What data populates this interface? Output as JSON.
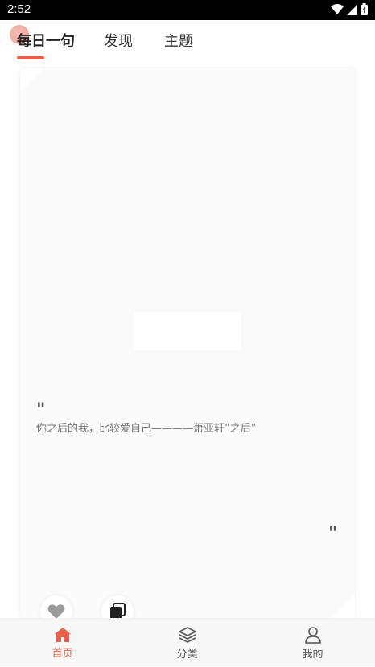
{
  "status_bar": {
    "time": "2:52"
  },
  "tabs": [
    {
      "label": "每日一句",
      "active": true
    },
    {
      "label": "发现",
      "active": false
    },
    {
      "label": "主题",
      "active": false
    }
  ],
  "card": {
    "quote_open": "\"",
    "quote_text": "你之后的我，比较爱自己————萧亚轩”之后”",
    "quote_close": "\""
  },
  "actions": {
    "like_icon": "heart-icon",
    "copy_icon": "copy-icon"
  },
  "bottom_nav": [
    {
      "label": "首页",
      "icon": "home-icon",
      "active": true
    },
    {
      "label": "分类",
      "icon": "layers-icon",
      "active": false
    },
    {
      "label": "我的",
      "icon": "user-icon",
      "active": false
    }
  ],
  "colors": {
    "accent": "#e8604c",
    "status_bar": "#000000"
  }
}
